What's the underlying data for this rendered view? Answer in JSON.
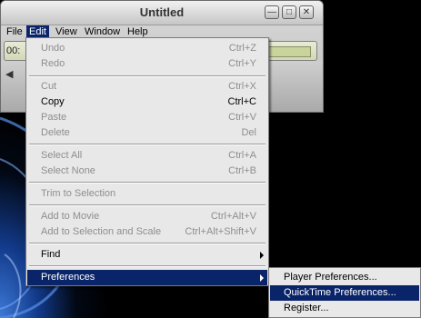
{
  "window": {
    "title": "Untitled",
    "time_text": "00:",
    "menubar": [
      "File",
      "Edit",
      "View",
      "Window",
      "Help"
    ],
    "active_menu": "Edit"
  },
  "edit_menu": {
    "items": [
      {
        "label": "Undo",
        "shortcut": "Ctrl+Z",
        "enabled": false
      },
      {
        "label": "Redo",
        "shortcut": "Ctrl+Y",
        "enabled": false
      },
      {
        "label": "Cut",
        "shortcut": "Ctrl+X",
        "enabled": false
      },
      {
        "label": "Copy",
        "shortcut": "Ctrl+C",
        "enabled": true
      },
      {
        "label": "Paste",
        "shortcut": "Ctrl+V",
        "enabled": false
      },
      {
        "label": "Delete",
        "shortcut": "Del",
        "enabled": false
      },
      {
        "label": "Select All",
        "shortcut": "Ctrl+A",
        "enabled": false
      },
      {
        "label": "Select None",
        "shortcut": "Ctrl+B",
        "enabled": false
      },
      {
        "label": "Trim to Selection",
        "shortcut": "",
        "enabled": false
      },
      {
        "label": "Add to Movie",
        "shortcut": "Ctrl+Alt+V",
        "enabled": false
      },
      {
        "label": "Add to Selection and Scale",
        "shortcut": "Ctrl+Alt+Shift+V",
        "enabled": false
      },
      {
        "label": "Find",
        "shortcut": "",
        "enabled": true,
        "submenu": true
      },
      {
        "label": "Preferences",
        "shortcut": "",
        "enabled": true,
        "submenu": true,
        "selected": true
      }
    ]
  },
  "preferences_submenu": {
    "items": [
      {
        "label": "Player Preferences...",
        "selected": false
      },
      {
        "label": "QuickTime Preferences...",
        "selected": true
      },
      {
        "label": "Register...",
        "selected": false
      }
    ]
  },
  "colors": {
    "selection": "#0a246a",
    "menu_bg": "#e8e8e8",
    "disabled_text": "#8e8e8e"
  }
}
